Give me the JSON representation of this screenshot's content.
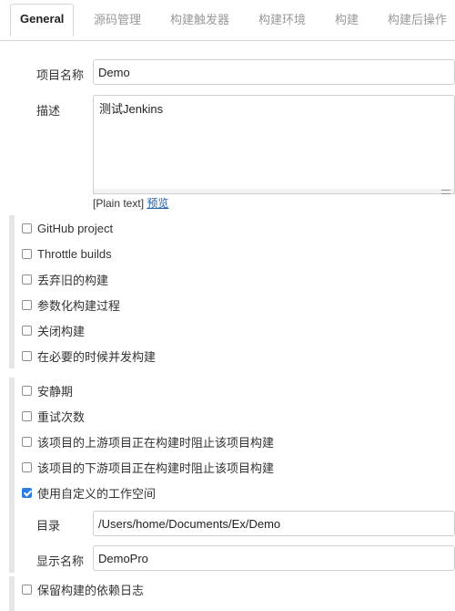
{
  "tabs": [
    {
      "label": "General",
      "active": true
    },
    {
      "label": "源码管理"
    },
    {
      "label": "构建触发器"
    },
    {
      "label": "构建环境"
    },
    {
      "label": "构建"
    },
    {
      "label": "构建后操作"
    }
  ],
  "form": {
    "project_name_label": "项目名称",
    "project_name_value": "Demo",
    "description_label": "描述",
    "description_value": "测试Jenkins",
    "plain_text": "[Plain text]",
    "preview_link": "预览"
  },
  "group1": [
    {
      "label": "GitHub project",
      "checked": false
    },
    {
      "label": "Throttle builds",
      "checked": false
    },
    {
      "label": "丢弃旧的构建",
      "checked": false
    },
    {
      "label": "参数化构建过程",
      "checked": false
    },
    {
      "label": "关闭构建",
      "checked": false
    },
    {
      "label": "在必要的时候并发构建",
      "checked": false
    }
  ],
  "group2": [
    {
      "label": "安静期",
      "checked": false
    },
    {
      "label": "重试次数",
      "checked": false
    },
    {
      "label": "该项目的上游项目正在构建时阻止该项目构建",
      "checked": false
    },
    {
      "label": "该项目的下游项目正在构建时阻止该项目构建",
      "checked": false
    },
    {
      "label": "使用自定义的工作空间",
      "checked": true
    }
  ],
  "workspace": {
    "directory_label": "目录",
    "directory_value": "/Users/home/Documents/Ex/Demo",
    "display_name_label": "显示名称",
    "display_name_value": "DemoPro"
  },
  "group3": [
    {
      "label": "保留构建的依赖日志",
      "checked": false
    }
  ],
  "colors": {
    "accent": "#2f7de1",
    "link": "#1f5fa8",
    "border": "#cfcfcf"
  }
}
